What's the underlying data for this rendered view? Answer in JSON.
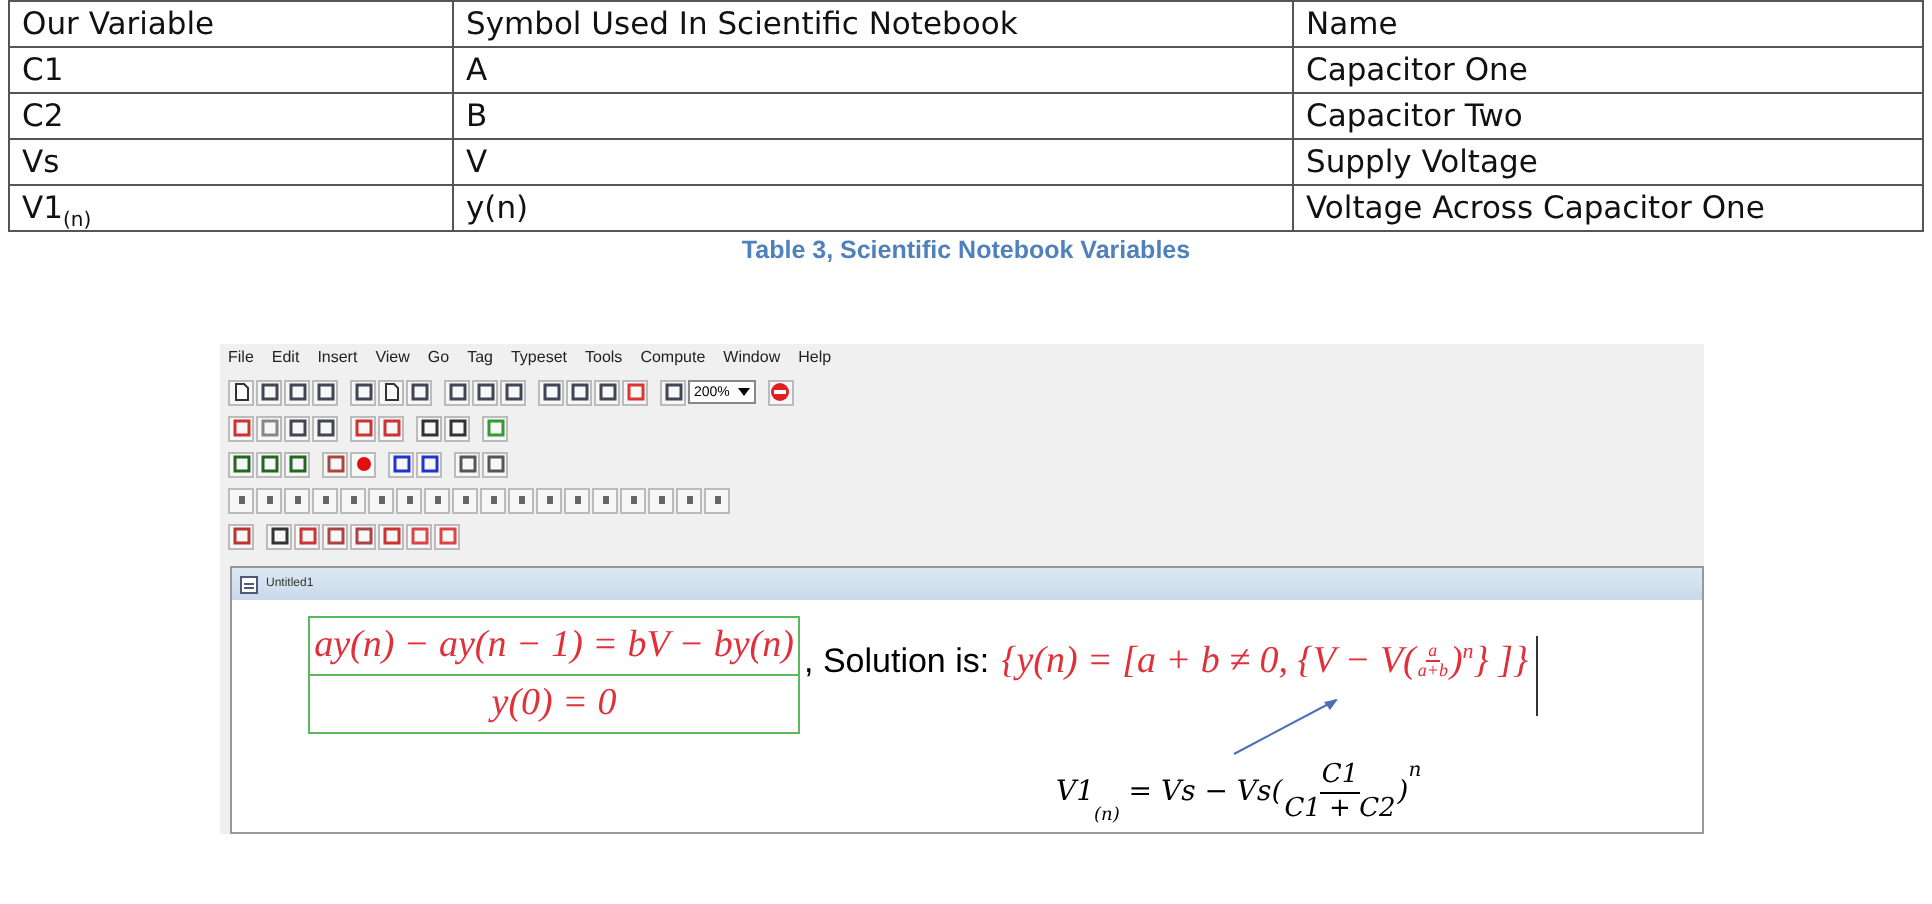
{
  "table": {
    "columns": [
      "Our Variable",
      "Symbol Used In Scientific Notebook",
      "Name"
    ],
    "rows": [
      [
        "C1",
        "A",
        "Capacitor One"
      ],
      [
        "C2",
        "B",
        "Capacitor Two"
      ],
      [
        "Vs",
        "V",
        "Supply Voltage"
      ],
      [
        "V1$_{(n)}$",
        "y(n)",
        "Voltage Across Capacitor One"
      ]
    ]
  },
  "caption": "Table 3, Scientific Notebook Variables",
  "screenshot": {
    "menu": [
      "File",
      "Edit",
      "Insert",
      "View",
      "Go",
      "Tag",
      "Typeset",
      "Tools",
      "Compute",
      "Window",
      "Help"
    ],
    "zoom": "200%",
    "document_title": "Untitled1",
    "equations": [
      "ay(n) − ay(n − 1) = bV − by(n)",
      "y(0) = 0"
    ],
    "solution_label": ", Solution is:",
    "solution": {
      "before": "{y(n) = [a + b ≠ 0, {V − V(",
      "numerator": "a",
      "denominator": "a+b",
      "after": ")",
      "power": "n",
      "end": "} ]}"
    },
    "formula": {
      "before": "V1",
      "subscript": "(n)",
      "middle": " = Vs − Vs(",
      "numerator": "C1",
      "denominator": "C1 + C2",
      "after": ")",
      "power": "n"
    }
  }
}
